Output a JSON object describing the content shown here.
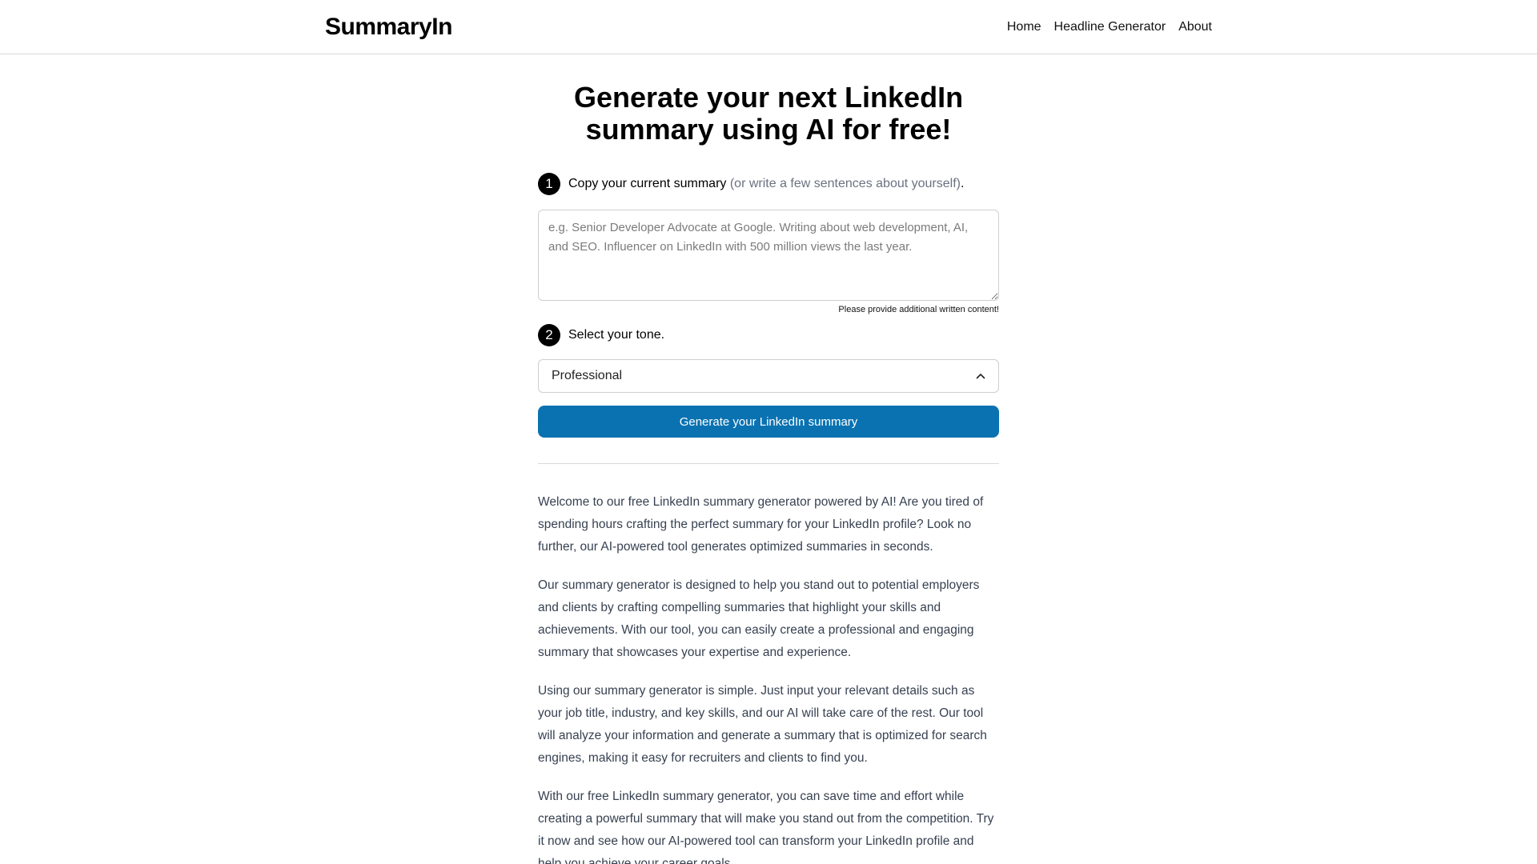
{
  "header": {
    "logo": "SummaryIn",
    "nav": [
      "Home",
      "Headline Generator",
      "About"
    ]
  },
  "main": {
    "title": "Generate your next LinkedIn summary using AI for free!",
    "step1": {
      "number": "1",
      "strong": "Copy your current summary",
      "muted": "(or write a few sentences about yourself)",
      "end": "."
    },
    "textarea": {
      "placeholder": "e.g. Senior Developer Advocate at Google. Writing about web development, AI, and SEO. Influencer on LinkedIn with 500 million views the last year."
    },
    "hint": "Please provide additional written content!",
    "step2": {
      "number": "2",
      "strong": "Select your tone."
    },
    "tone": {
      "selected": "Professional"
    },
    "button_label": "Generate your LinkedIn summary",
    "paragraphs": [
      "Welcome to our free LinkedIn summary generator powered by AI! Are you tired of spending hours crafting the perfect summary for your LinkedIn profile? Look no further, our AI-powered tool generates optimized summaries in seconds.",
      "Our summary generator is designed to help you stand out to potential employers and clients by crafting compelling summaries that highlight your skills and achievements. With our tool, you can easily create a professional and engaging summary that showcases your expertise and experience.",
      "Using our summary generator is simple. Just input your relevant details such as your job title, industry, and key skills, and our AI will take care of the rest. Our tool will analyze your information and generate a summary that is optimized for search engines, making it easy for recruiters and clients to find you.",
      "With our free LinkedIn summary generator, you can save time and effort while creating a powerful summary that will make you stand out from the competition. Try it now and see how our AI-powered tool can transform your LinkedIn profile and help you achieve your career goals."
    ]
  },
  "colors": {
    "button": "#0a72b1",
    "muted_text": "#6b7280"
  },
  "icons": {
    "select": "chevron-up-icon"
  }
}
